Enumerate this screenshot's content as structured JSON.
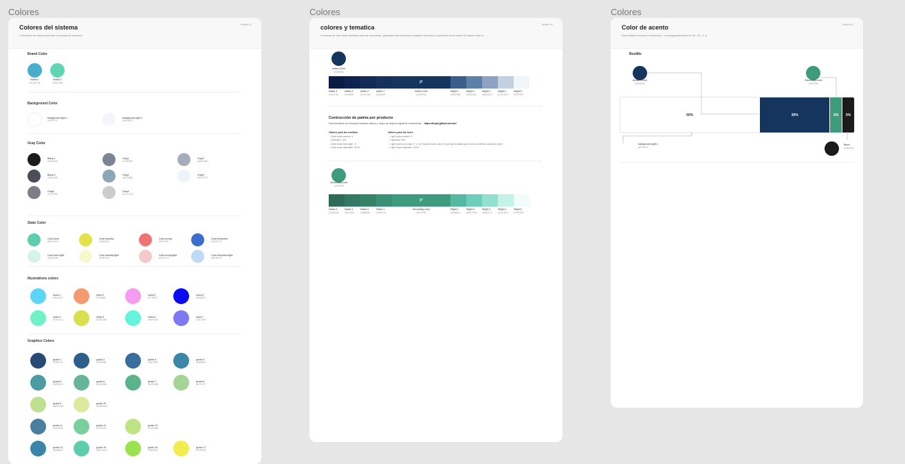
{
  "frames": {
    "left_label": "Colores",
    "mid_label": "Colores",
    "right_label": "Colores"
  },
  "system": {
    "title": "Colores del sistema",
    "subtitle": "Colecciones de colores para todo el producto de productos",
    "version": "Versión 01",
    "brand": {
      "title": "Brand Color",
      "items": [
        {
          "name": "Brand 1",
          "hex": "#4CAFCB",
          "color": "#4aaecb"
        },
        {
          "name": "Brand 2",
          "hex": "#5CD7B5",
          "color": "#5fd6b5"
        }
      ]
    },
    "background": {
      "title": "Background Color",
      "items": [
        {
          "name": "background-light-1",
          "hex": "#FFFFFF",
          "color": "#ffffff"
        },
        {
          "name": "background-light-2",
          "hex": "#F6F6FB",
          "color": "#f4f5fa"
        }
      ]
    },
    "gray": {
      "title": "Gray Color",
      "items": [
        {
          "name": "Black-1",
          "hex": "#1B1B1B",
          "color": "#1b1b1b"
        },
        {
          "name": "Gray1",
          "hex": "#7C8A99",
          "color": "#7a8694"
        },
        {
          "name": "Gray3",
          "hex": "#A6ACBC",
          "color": "#a7acbb"
        },
        {
          "name": "Black-2",
          "hex": "#4B4D58",
          "color": "#4b4d58"
        },
        {
          "name": "Gray2",
          "hex": "#8CA8B6",
          "color": "#8ba6b5"
        },
        {
          "name": "Gray5",
          "hex": "#EFF2F9",
          "color": "#eef2f9"
        },
        {
          "name": "Gray6",
          "hex": "#7C7F88",
          "color": "#7c7f88"
        },
        {
          "name": "Gray4",
          "hex": "#CCCCD1",
          "color": "#cbcbd0"
        }
      ]
    },
    "state": {
      "title": "State Color",
      "items": [
        {
          "name": "Color.done",
          "hex": "#5ECDAC",
          "color": "#5ecdac"
        },
        {
          "name": "Color.standby",
          "hex": "#E5E44A",
          "color": "#e4e24b"
        },
        {
          "name": "Color.wrong",
          "hex": "#F07878",
          "color": "#ef7373"
        },
        {
          "name": "Color.temprana",
          "hex": "#3A70CD",
          "color": "#3a6fcd"
        },
        {
          "name": "Color.done.light",
          "hex": "#D6F3EB",
          "color": "#d6f3eb"
        },
        {
          "name": "Color.standby.light",
          "hex": "#F8F9CD",
          "color": "#f7f8cc"
        },
        {
          "name": "Color.wrong.light",
          "hex": "#F6CFCF",
          "color": "#f5c9c9"
        },
        {
          "name": "Color.temprana.light",
          "hex": "#BED9F5",
          "color": "#bedaf5"
        }
      ]
    },
    "illustrations": {
      "title": "Illustrations colors",
      "items": [
        {
          "name": "Isolor.1",
          "hex": "#5CD6F7",
          "color": "#5cd6f7"
        },
        {
          "name": "Isolor.2",
          "hex": "#F39B6F",
          "color": "#f39a6e"
        },
        {
          "name": "Isolor.5",
          "hex": "#F79EF9",
          "color": "#f59bf2"
        },
        {
          "name": "Isolor.8",
          "hex": "#0A0BF2",
          "color": "#0b0bf2"
        },
        {
          "name": "Isolor.3",
          "hex": "#70F2C4",
          "color": "#6ff3c6"
        },
        {
          "name": "Isolor.4",
          "hex": "#D9E24B",
          "color": "#d8e14c"
        },
        {
          "name": "Isolor.6",
          "hex": "#5FF3DE",
          "color": "#63f3df"
        },
        {
          "name": "Isolor.7",
          "hex": "#7E7AF5",
          "color": "#7e78f2"
        }
      ]
    },
    "graphics": {
      "title": "Graphics Colors",
      "items": [
        {
          "name": "gcolor.1",
          "hex": "#2B4C75",
          "color": "#264a74"
        },
        {
          "name": "gcolor.2",
          "hex": "#2F5F8B",
          "color": "#2e5e8c"
        },
        {
          "name": "gcolor.3",
          "hex": "#3A709B",
          "color": "#386f9c"
        },
        {
          "name": "gcolor.4",
          "hex": "#3A89A9",
          "color": "#3c86aa"
        },
        {
          "name": "gcolor.5",
          "hex": "#4E9EA3",
          "color": "#4d9ca3"
        },
        {
          "name": "gcolor.6",
          "hex": "#6CB69B",
          "color": "#66b59b"
        },
        {
          "name": "gcolor.7",
          "hex": "#5CB48B",
          "color": "#5ab389"
        },
        {
          "name": "gcolor.8",
          "hex": "#A7D797",
          "color": "#a5d496"
        },
        {
          "name": "gcolor.9",
          "hex": "#BEE29B",
          "color": "#bde08e"
        },
        {
          "name": "gcolor.10",
          "hex": "#DEEBA6",
          "color": "#dcea9e"
        },
        {
          "name": "gcolor.11",
          "hex": "#4A7B9A",
          "color": "#497f9e"
        },
        {
          "name": "gcolor.12",
          "hex": "#7ED09A",
          "color": "#7acf9e"
        },
        {
          "name": "gcolor.13",
          "hex": "#C0E38B",
          "color": "#c0e386"
        },
        {
          "name": "gcolor.14",
          "hex": "#3A86A9",
          "color": "#3a86aa"
        },
        {
          "name": "gcolor.15",
          "hex": "#5ECDAC",
          "color": "#5ecdac"
        },
        {
          "name": "gcolor.16",
          "hex": "#9BE35C",
          "color": "#9be34e"
        },
        {
          "name": "gcolor.17",
          "hex": "#F2EB51",
          "color": "#f2ec4e"
        }
      ]
    }
  },
  "theme": {
    "title": "colores y tematica",
    "subtitle": "Los temas de color están diseñados para ser armoniosos, garantizar texto accesible y distinguir elementos y superficies de la interfaz de usuario entre sí.",
    "version": "Versión 01",
    "action": {
      "name": "action-Color",
      "hex": "#1E3F6A",
      "color": "#15355f"
    },
    "action_scale": [
      {
        "label": "Adark-4",
        "hex": "#0A1F44",
        "color": "#0b1c45"
      },
      {
        "label": "Adark-3",
        "hex": "#102650",
        "color": "#0f2350"
      },
      {
        "label": "Adark-2",
        "hex": "#142C5B",
        "color": "#132b58"
      },
      {
        "label": "Adark-1",
        "hex": "#18325F",
        "color": "#17315f"
      },
      {
        "label": "Action-color",
        "hex": "#1E3F6A",
        "color": "#15355f",
        "mid": true,
        "mark": "P"
      },
      {
        "label": "Alight-1",
        "hex": "#3F5F8B",
        "color": "#3b5f8b"
      },
      {
        "label": "Alight-2",
        "hex": "#5E80A8",
        "color": "#5d80a9"
      },
      {
        "label": "Alight-3",
        "hex": "#8DA3C1",
        "color": "#8da3c1"
      },
      {
        "label": "Alight-4",
        "hex": "#C2CEE0",
        "color": "#c2d0e0"
      },
      {
        "label": "Alight-5",
        "hex": "#F2F5F9",
        "color": "#f2f5fa"
      }
    ],
    "palette": {
      "title": "Contrucción de paleta por producto",
      "desc": "Para tematizar los enfoques basados blanco y negro se utiliza la siguiente herramienta",
      "link": "https://lbrpal.github.io/code/",
      "dark_title": "Valores para las sombras",
      "dark_items": [
        "Dark colors amount: 4",
        "Darkness: 10%",
        "Dark colors hue angle: -5",
        "Dark colors saturation: 100%"
      ],
      "light_title": "Valores para las luces",
      "light_items": [
        "Light colors amount: 5",
        "Lightness: 96%",
        "Light colors hue angle: (+ o -5) (Tomando como valor 10 que hay tonalidad que el color se defecto cambie de color)",
        "Light colors saturation: 100%"
      ]
    },
    "secondary": {
      "name": "Secondary-color",
      "hex": "#3F9F82",
      "color": "#3f9b7e"
    },
    "secondary_scale": [
      {
        "label": "Sdark-4",
        "hex": "#2D6A56",
        "color": "#2e6c57"
      },
      {
        "label": "Sdark-3",
        "hex": "#327A63",
        "color": "#337964"
      },
      {
        "label": "Sdark-2",
        "hex": "#36866D",
        "color": "#368468"
      },
      {
        "label": "Sdark-1",
        "hex": "#3A9076",
        "color": "#399074"
      },
      {
        "label": "Secondary-color",
        "hex": "#3F9F82",
        "color": "#3f9b7e",
        "mid": true,
        "mark": "P"
      },
      {
        "label": "Slight-1",
        "hex": "#52B8A1",
        "color": "#55b9a2"
      },
      {
        "label": "Slight-2",
        "hex": "#6DCFBC",
        "color": "#6bcfbb"
      },
      {
        "label": "Slight-3",
        "hex": "#93E0CF",
        "color": "#93e0cf"
      },
      {
        "label": "Slight-4",
        "hex": "#C4F4E9",
        "color": "#c3f2e7"
      },
      {
        "label": "Slight-5",
        "hex": "#F0FBF9",
        "color": "#f0fcf9"
      }
    ]
  },
  "accent": {
    "title": "Color de acento",
    "subtitle": "Para enfatizar acciones o información - La configuración parte de: 60 - 30 - 5 - 5",
    "version": "Versión 01",
    "section": "BoxMix",
    "action": {
      "name": "Action - Color",
      "hex": "#1E3F6A",
      "color": "#15355f"
    },
    "secondary": {
      "name": "Secondary-color",
      "hex": "#3F9F82",
      "color": "#3f9b7e"
    },
    "bg": {
      "name": "background-light-1",
      "hex": "#FFFFFF"
    },
    "black": {
      "name": "Black",
      "hex": "#1B1B1B",
      "color": "#1b1b1b"
    },
    "mix": [
      {
        "pct": "60%",
        "value": 60,
        "color": "#ffffff",
        "text": "#333333"
      },
      {
        "pct": "30%",
        "value": 30,
        "color": "#15355f",
        "text": "#ffffff"
      },
      {
        "pct": "5%",
        "value": 5,
        "color": "#3f9b7e",
        "text": "#ffffff"
      },
      {
        "pct": "5%",
        "value": 5,
        "color": "#1b1b1b",
        "text": "#ffffff"
      }
    ]
  }
}
